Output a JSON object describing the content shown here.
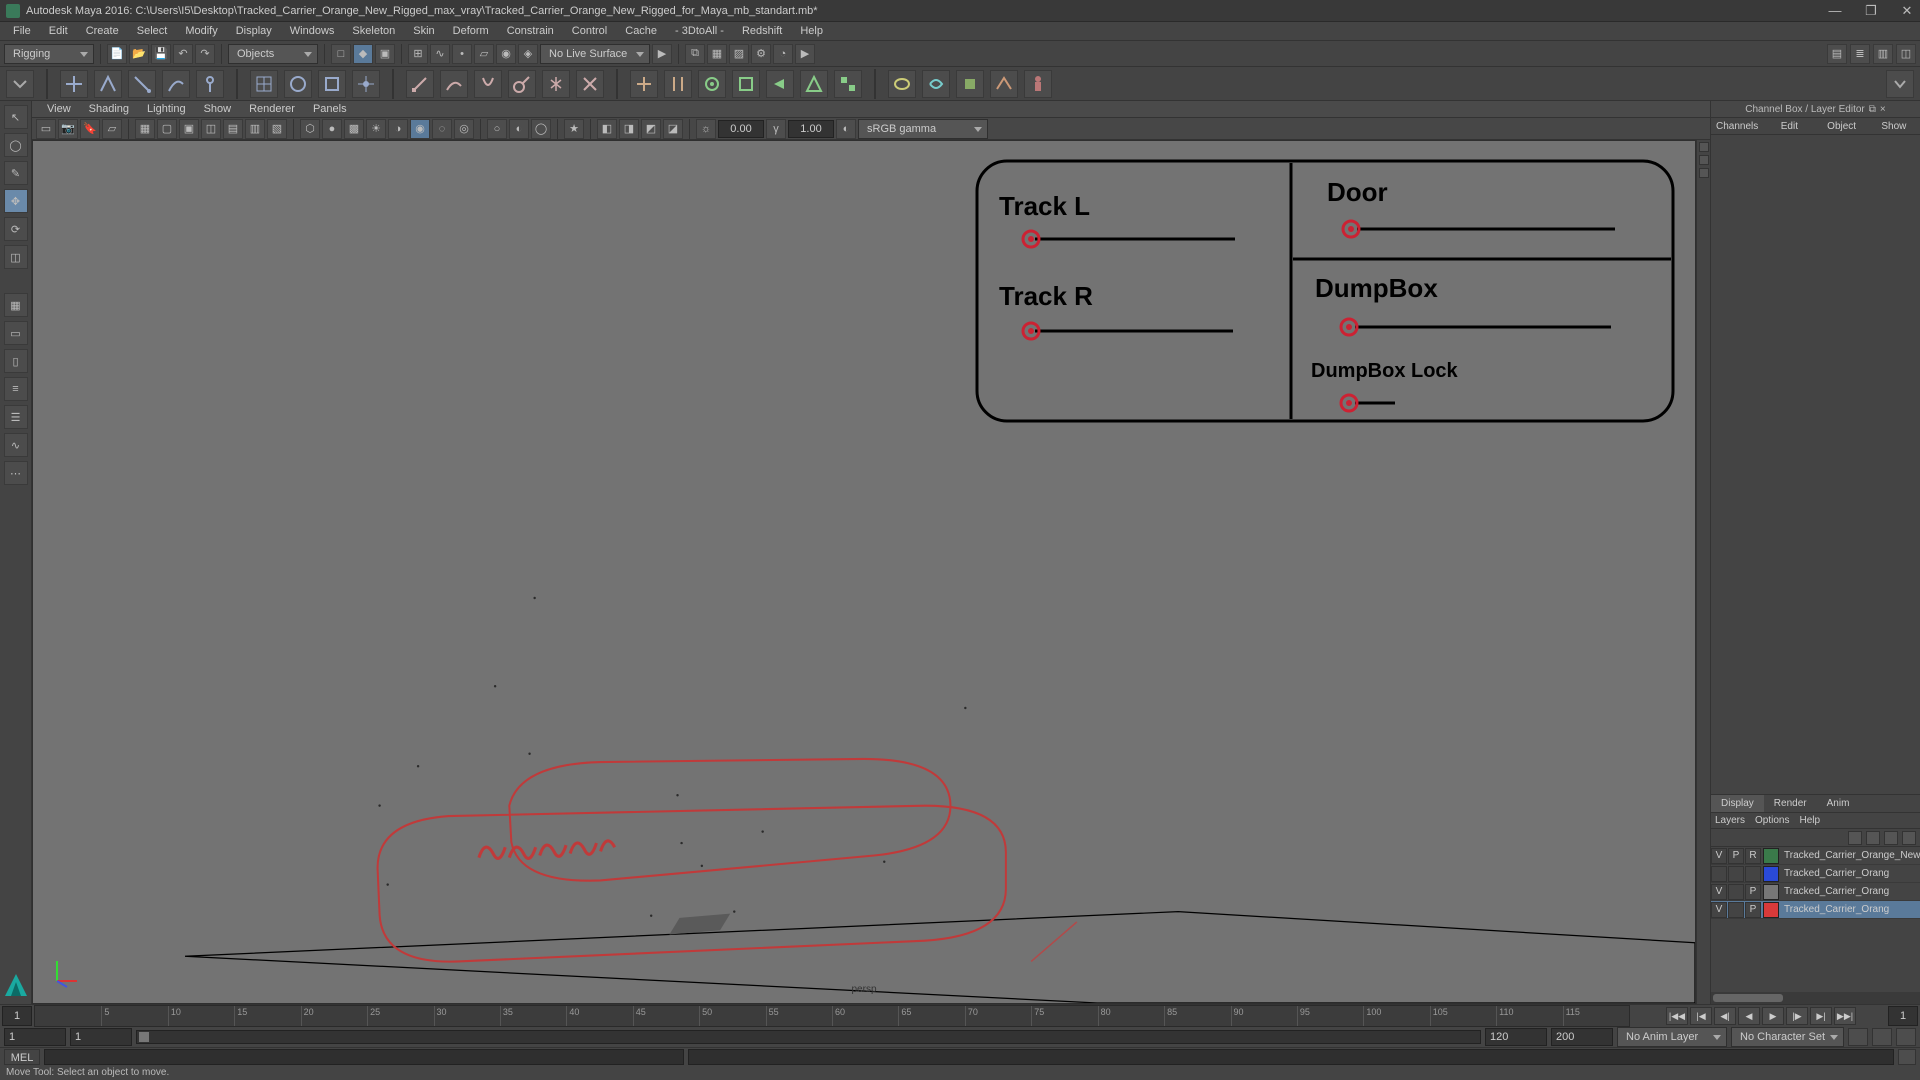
{
  "window": {
    "title": "Autodesk Maya 2016: C:\\Users\\I5\\Desktop\\Tracked_Carrier_Orange_New_Rigged_max_vray\\Tracked_Carrier_Orange_New_Rigged_for_Maya_mb_standart.mb*"
  },
  "menubar": [
    "File",
    "Edit",
    "Create",
    "Select",
    "Modify",
    "Display",
    "Windows",
    "Skeleton",
    "Skin",
    "Deform",
    "Constrain",
    "Control",
    "Cache",
    "- 3DtoAll -",
    "Redshift",
    "Help"
  ],
  "shelf": {
    "mode": "Rigging",
    "mask": "Objects",
    "surface": "No Live Surface"
  },
  "panel": {
    "menus": [
      "View",
      "Shading",
      "Lighting",
      "Show",
      "Renderer",
      "Panels"
    ],
    "near": "0.00",
    "far": "1.00",
    "colorspace": "sRGB gamma",
    "camera": "persp"
  },
  "hud": {
    "track_l": "Track L",
    "track_r": "Track R",
    "door": "Door",
    "dumpbox": "DumpBox",
    "dumpbox_lock": "DumpBox Lock"
  },
  "channelBox": {
    "title": "Channel Box / Layer Editor",
    "tabs": [
      "Channels",
      "Edit",
      "Object",
      "Show"
    ]
  },
  "layerEditor": {
    "tabs": [
      "Display",
      "Render",
      "Anim"
    ],
    "menu": [
      "Layers",
      "Options",
      "Help"
    ],
    "layers": [
      {
        "v": "V",
        "p": "P",
        "r": "R",
        "color": "#3a7a4a",
        "name": "Tracked_Carrier_Orange_New"
      },
      {
        "v": "",
        "p": "",
        "r": "",
        "color": "#2a4ad8",
        "name": "Tracked_Carrier_Orang"
      },
      {
        "v": "V",
        "p": "",
        "r": "P",
        "color": "#777",
        "name": "Tracked_Carrier_Orang"
      },
      {
        "v": "V",
        "p": "",
        "r": "P",
        "color": "#d83a3a",
        "name": "Tracked_Carrier_Orang",
        "selected": true
      }
    ]
  },
  "timeline": {
    "start_cap": "1",
    "end_cap": "1",
    "ticks": [
      5,
      10,
      15,
      20,
      25,
      30,
      35,
      40,
      45,
      50,
      55,
      60,
      65,
      70,
      75,
      80,
      85,
      90,
      95,
      100,
      105,
      110,
      115
    ],
    "range_start": "1",
    "range_in": "1",
    "range_out": "120",
    "range_end": "200",
    "anim_layer": "No Anim Layer",
    "char_set": "No Character Set"
  },
  "cmd": {
    "lang": "MEL"
  },
  "help": "Move Tool: Select an object to move."
}
